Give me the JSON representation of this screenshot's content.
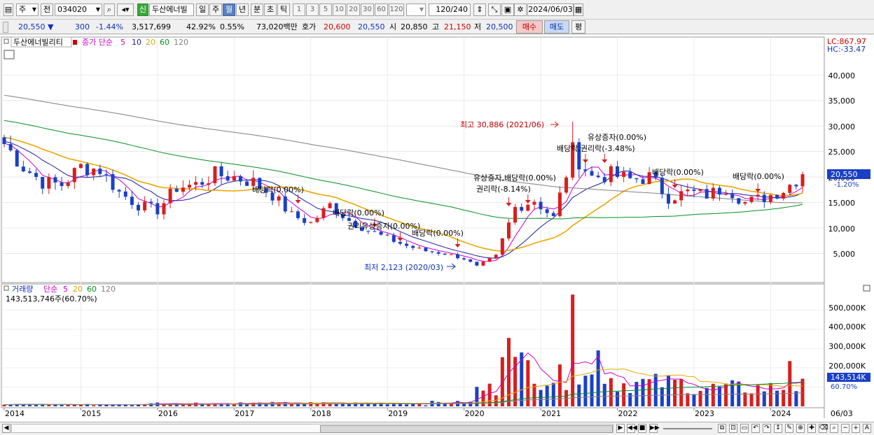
{
  "toolbar": {
    "mode": "주",
    "prev_label": "전",
    "code": "034020",
    "new_badge": "신",
    "stock_name": "두산에너빌",
    "period_tabs": [
      "일",
      "주",
      "월",
      "년",
      "분",
      "초",
      "틱"
    ],
    "selected_period": "월",
    "interval_buttons": [
      "1",
      "3",
      "5",
      "10",
      "20",
      "30",
      "60",
      "120"
    ],
    "count_value": "120",
    "count_total": "/240",
    "date_value": "2024/06/03"
  },
  "quote": {
    "price": "20,550",
    "direction_symbol": "▼",
    "change": "300",
    "change_pct": "-1.44%",
    "volume": "3,517,699",
    "vol_ratio": "42.92%",
    "turnover": "0.55%",
    "amount": "73,020백만",
    "ask_label": "호가",
    "ask": "20,600",
    "bid": "20,550",
    "open_label": "시",
    "open": "20,850",
    "high_label": "고",
    "high": "21,150",
    "low_label": "저",
    "low": "20,500",
    "buy_label": "매수",
    "sell_label": "매도",
    "eval_label": "평"
  },
  "price_pane": {
    "stock_label": "두산에너빌리티",
    "ma_title": "종가 단순",
    "ma_periods": [
      "5",
      "10",
      "20",
      "60",
      "120"
    ],
    "ma_colors": [
      "#d000d0",
      "#1a1aa0",
      "#e8a800",
      "#009020",
      "#808080"
    ],
    "lc_label": "LC:867.97",
    "hc_label": "HC:-33.47",
    "last_price_tag": "20,550",
    "last_pct_tag": "-1.20%",
    "y_ticks": [
      "40,000",
      "35,000",
      "30,000",
      "25,000",
      "20,000",
      "15,000",
      "10,000",
      "5,000"
    ],
    "annotations": {
      "high": "최고 30,886 (2021/06)",
      "low": "최저 2,123 (2020/03)",
      "div_2017": "배당락(0.00%)",
      "div_2018": "배당락(0.00%)",
      "rights_2018": "권리유상증자(0.00%)",
      "div_2019": "배당락(0.00%)",
      "rights_2020a": "유상증자,배당락(0.00%)",
      "rights_2020b": "권리락(-8.14%)",
      "rights_2021a": "유상증자(0.00%)",
      "rights_2021b": "배당락,권리락(-3.48%)",
      "div_2022": "배당락(0.00%)",
      "div_2023": "배당락(0.00%)"
    }
  },
  "volume_pane": {
    "title": "거래량",
    "ma_title": "단순",
    "ma_periods": [
      "5",
      "20",
      "60",
      "120"
    ],
    "ma_colors": [
      "#d000d0",
      "#e8a800",
      "#009020",
      "#808080"
    ],
    "last_value": "143,513,746주(60.70%)",
    "last_tag": "143,514K",
    "last_pct_tag": "60.70%",
    "y_ticks": [
      "500,000K",
      "400,000K",
      "300,000K",
      "200,000K",
      "100,000K"
    ]
  },
  "x_axis": {
    "labels": [
      "2014",
      "2015",
      "2016",
      "2017",
      "2018",
      "2019",
      "2020",
      "2021",
      "2022",
      "2023",
      "2024"
    ],
    "end_label": "06/03"
  },
  "chart_data": {
    "type": "candlestick",
    "interval": "monthly",
    "x_range": [
      "2014-01",
      "2024-06"
    ],
    "y_range": [
      0,
      45000
    ],
    "points_note": "approximate monthly closes read from chart",
    "closes": [
      {
        "t": "2014-01",
        "c": 26500
      },
      {
        "t": "2014-04",
        "c": 22000
      },
      {
        "t": "2014-07",
        "c": 19000
      },
      {
        "t": "2014-10",
        "c": 18500
      },
      {
        "t": "2015-01",
        "c": 22000
      },
      {
        "t": "2015-04",
        "c": 21500
      },
      {
        "t": "2015-07",
        "c": 17000
      },
      {
        "t": "2015-10",
        "c": 14500
      },
      {
        "t": "2016-01",
        "c": 13500
      },
      {
        "t": "2016-04",
        "c": 18000
      },
      {
        "t": "2016-07",
        "c": 18500
      },
      {
        "t": "2016-10",
        "c": 20500
      },
      {
        "t": "2017-01",
        "c": 20000
      },
      {
        "t": "2017-04",
        "c": 19000
      },
      {
        "t": "2017-07",
        "c": 16500
      },
      {
        "t": "2017-10",
        "c": 12500
      },
      {
        "t": "2018-01",
        "c": 11000
      },
      {
        "t": "2018-04",
        "c": 14500
      },
      {
        "t": "2018-07",
        "c": 11500
      },
      {
        "t": "2018-10",
        "c": 9500
      },
      {
        "t": "2019-01",
        "c": 8000
      },
      {
        "t": "2019-04",
        "c": 6500
      },
      {
        "t": "2019-07",
        "c": 5500
      },
      {
        "t": "2019-10",
        "c": 5000
      },
      {
        "t": "2020-01",
        "c": 4000
      },
      {
        "t": "2020-03",
        "c": 2500
      },
      {
        "t": "2020-06",
        "c": 4500
      },
      {
        "t": "2020-09",
        "c": 14000
      },
      {
        "t": "2020-12",
        "c": 15500
      },
      {
        "t": "2021-03",
        "c": 12000
      },
      {
        "t": "2021-06",
        "c": 25000
      },
      {
        "t": "2021-09",
        "c": 20000
      },
      {
        "t": "2021-12",
        "c": 20500
      },
      {
        "t": "2022-03",
        "c": 19500
      },
      {
        "t": "2022-06",
        "c": 20000
      },
      {
        "t": "2022-09",
        "c": 16000
      },
      {
        "t": "2022-12",
        "c": 17000
      },
      {
        "t": "2023-03",
        "c": 16500
      },
      {
        "t": "2023-06",
        "c": 18000
      },
      {
        "t": "2023-09",
        "c": 15000
      },
      {
        "t": "2023-12",
        "c": 16000
      },
      {
        "t": "2024-03",
        "c": 17500
      },
      {
        "t": "2024-06",
        "c": 20550
      }
    ],
    "high": {
      "value": 30886,
      "date": "2021/06"
    },
    "low": {
      "value": 2123,
      "date": "2020/03"
    },
    "last_volume": 143513746
  }
}
